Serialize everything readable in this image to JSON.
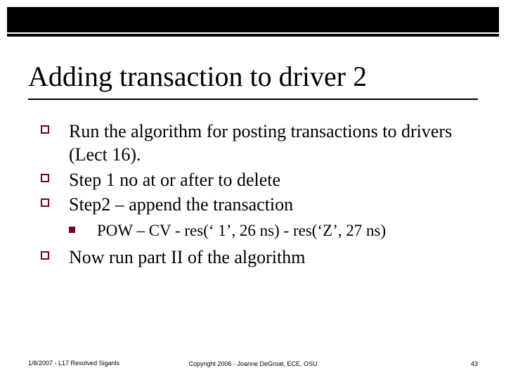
{
  "title": "Adding transaction to driver 2",
  "bullets": {
    "b1": "Run the algorithm for posting transactions to drivers (Lect 16).",
    "b2": "Step 1 no at or after to delete",
    "b3": "Step2 – append the transaction",
    "b3_sub1": "POW – CV - res(‘ 1’, 26 ns) - res(‘Z’, 27 ns)",
    "b4": "Now run part II of the algorithm"
  },
  "footer": {
    "left": "1/8/2007 - L17 Resolved Siganls",
    "center": "Copyright 2006 - Joanne DeGroat, ECE, OSU",
    "right": "43"
  }
}
